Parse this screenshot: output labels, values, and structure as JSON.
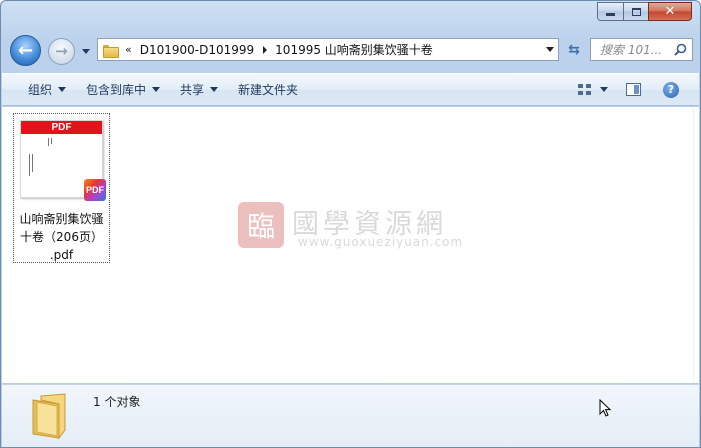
{
  "window": {
    "caption": {
      "minimize_glyph": "",
      "maximize_glyph": "",
      "close_glyph": "✕"
    }
  },
  "nav": {
    "back_icon": "back-arrow-icon",
    "forward_icon": "forward-arrow-icon",
    "breadcrumb": {
      "overflow": "«",
      "items": [
        "D101900-D101999",
        "101995 山响斋别集饮骚十卷"
      ]
    },
    "refresh_icon": "refresh-icon",
    "search_placeholder": "搜索 101...",
    "search_icon": "magnifier-icon"
  },
  "toolbar": {
    "items": [
      {
        "label": "组织",
        "dropdown": true
      },
      {
        "label": "包含到库中",
        "dropdown": true
      },
      {
        "label": "共享",
        "dropdown": true
      },
      {
        "label": "新建文件夹",
        "dropdown": false
      }
    ],
    "help_glyph": "?"
  },
  "files": [
    {
      "name": "山响斋别集饮骚十卷（206页）.pdf",
      "name_lines": [
        "山响斋别集饮骚",
        "十卷（206页）",
        ".pdf"
      ],
      "thumb_label": "PDF",
      "badge_label": "PDF",
      "selected": true
    }
  ],
  "watermark": {
    "logo_glyph": "臨",
    "title": "國學資源網",
    "url": "www.guoxueziyuan.com"
  },
  "status": {
    "count_text": "1 个对象"
  },
  "colors": {
    "pdf_red": "#e0141b",
    "toolbar_text": "#1e395b",
    "window_frame": "#bcd2ec"
  }
}
